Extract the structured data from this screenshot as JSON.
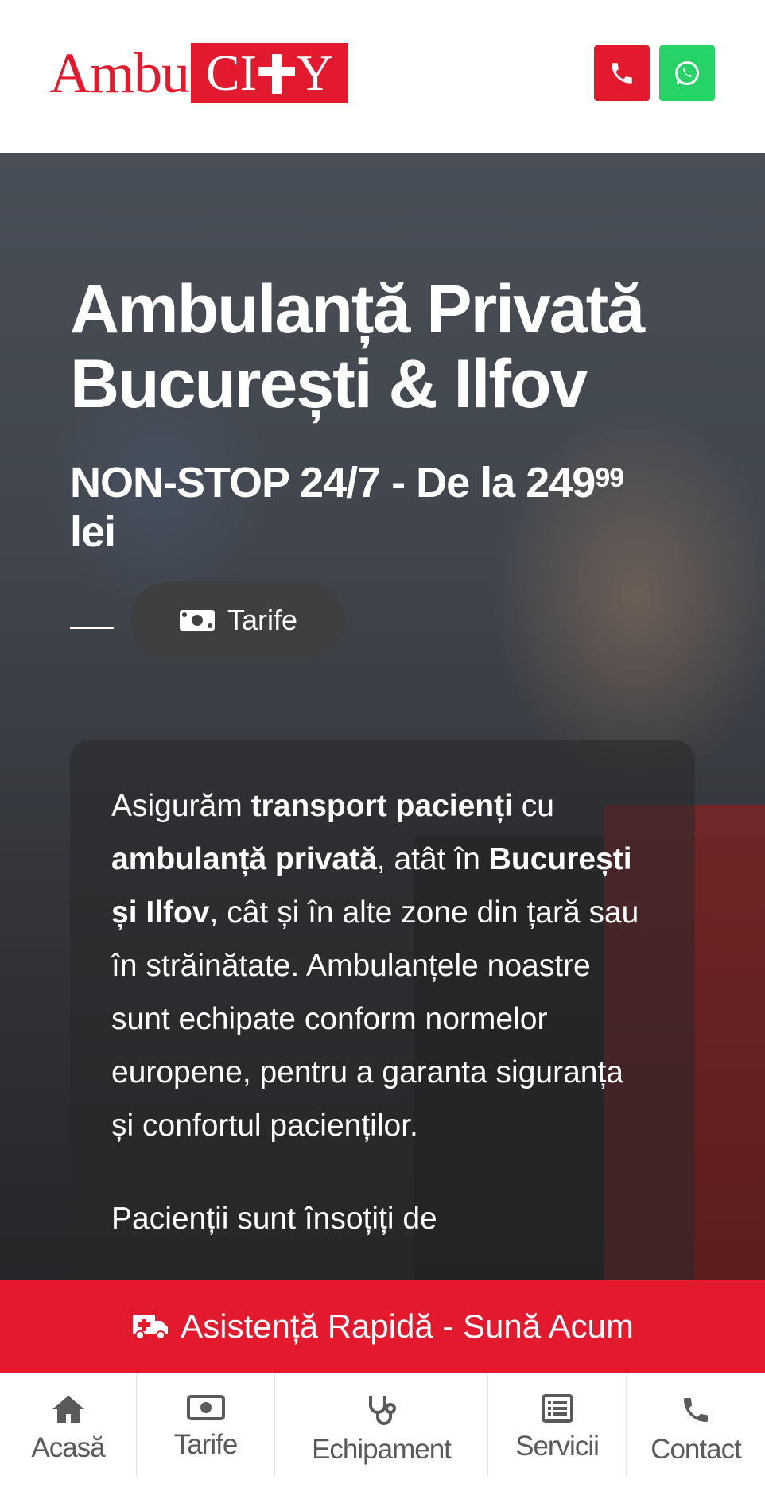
{
  "header": {
    "logo": {
      "left_text": "Ambu",
      "right_text_a": "CI",
      "right_text_b": "Y"
    },
    "call_icon": "phone-icon",
    "whatsapp_icon": "whatsapp-icon",
    "colors": {
      "brand_red": "#e3192e",
      "whatsapp_green": "#25d366"
    }
  },
  "hero": {
    "title": "Ambulanță Privată București & Ilfov",
    "subtitle_main": "NON-STOP 24/7 - De la 249",
    "subtitle_sup": "99",
    "subtitle_unit": "lei",
    "tarife_button": {
      "icon": "money-icon",
      "label": "Tarife"
    }
  },
  "info": {
    "p1": {
      "t1": "Asigurăm ",
      "b1": "transport pacienți",
      "t2": " cu ",
      "b2": "ambulanță privată",
      "t3": ", atât în ",
      "b3": "București și Ilfov",
      "t4": ", cât și în alte zone din țară sau în străinătate. Ambulanțele noastre sunt echipate conform normelor europene, pentru a garanta siguranța și confortul pacienților."
    },
    "p2": "Pacienții sunt însoțiți de"
  },
  "cta": {
    "icon": "ambulance-icon",
    "label": "Asistență Rapidă - Sună Acum"
  },
  "bottom_nav": {
    "items": [
      {
        "icon": "home-icon",
        "label": "Acasă"
      },
      {
        "icon": "money-icon",
        "label": "Tarife"
      },
      {
        "icon": "stethoscope-icon",
        "label": "Echipament"
      },
      {
        "icon": "list-icon",
        "label": "Servicii"
      },
      {
        "icon": "phone-icon",
        "label": "Contact"
      }
    ]
  }
}
